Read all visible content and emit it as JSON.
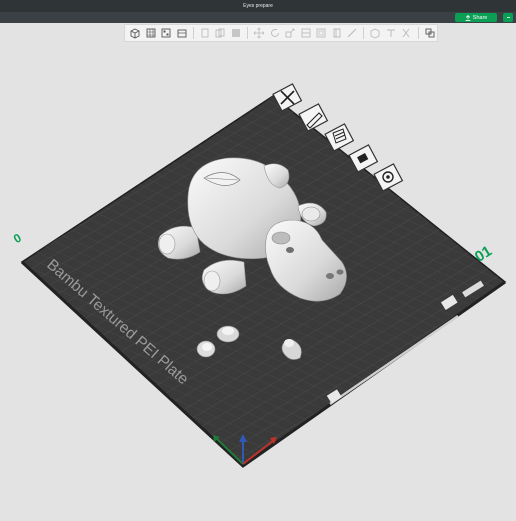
{
  "app": {
    "window_title": "Eyes prepare"
  },
  "header": {
    "share_label": "Share",
    "share_icon": "upload-icon",
    "extra_icon": "minus-icon"
  },
  "toolbar": {
    "tools": [
      "add-object-icon",
      "add-plate-icon",
      "arrange-icon",
      "orient-icon",
      "copy-icon",
      "paste-icon",
      "layers-icon",
      "move-icon",
      "rotate-icon",
      "scale-icon",
      "cut-icon",
      "support-paint-icon",
      "seam-icon",
      "measure-icon",
      "assembly-icon",
      "text-icon",
      "split-icon",
      "view-icon"
    ]
  },
  "plate": {
    "name": "Bambu Textured PEI Plate",
    "plate_number": "01",
    "corner_mark": "0",
    "controls": [
      "close-plate-icon",
      "edit-plate-icon",
      "arrange-plate-icon",
      "lock-plate-icon",
      "settings-plate-icon"
    ]
  },
  "colors": {
    "accent": "#0b9e55",
    "plate": "#3a3a3a",
    "plate_grid": "#4b4b4b",
    "axis_x": "#c0322a",
    "axis_y": "#1f7a3a",
    "axis_z": "#2f59b8"
  }
}
